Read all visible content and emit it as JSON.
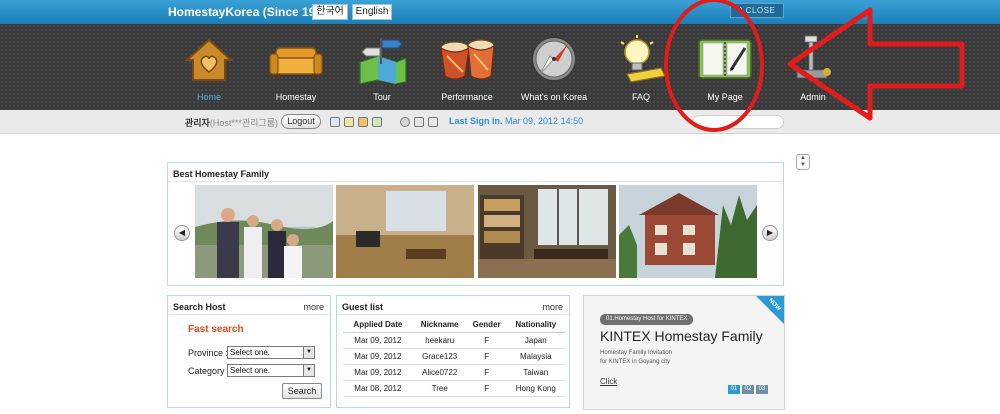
{
  "topbar": {
    "brand": "HomestayKorea (Since 1998)",
    "lang_korean": "한국어",
    "lang_english": "English",
    "close_label": "^ CLOSE"
  },
  "nav": {
    "items": [
      {
        "label": "Home",
        "icon": "home-heart-icon",
        "active": true
      },
      {
        "label": "Homestay",
        "icon": "sofa-icon"
      },
      {
        "label": "Tour",
        "icon": "map-signpost-icon"
      },
      {
        "label": "Performance",
        "icon": "drums-icon"
      },
      {
        "label": "What's on Korea",
        "icon": "compass-icon"
      },
      {
        "label": "FAQ",
        "icon": "lightbulb-icon"
      },
      {
        "label": "My Page",
        "icon": "notebook-pen-icon"
      },
      {
        "label": "Admin",
        "icon": "tools-icon"
      }
    ]
  },
  "login": {
    "user_name": "관리자",
    "user_sub": "(Host***관리그룹)",
    "logout_label": "Logout",
    "last_sign_label": "Last Sign in.",
    "last_sign_value": "Mar 09, 2012 14:50"
  },
  "best": {
    "title": "Best Homestay Family"
  },
  "search_host": {
    "title": "Search Host",
    "more": "more",
    "fast_search": "Fast search",
    "province_label": "Province :",
    "province_value": "Select one.",
    "category_label": "Category :",
    "category_value": "Select one.",
    "search_button": "Search"
  },
  "guest_list": {
    "title": "Guest list",
    "more": "more",
    "columns": [
      "Applied Date",
      "Nickname",
      "Gender",
      "Nationality"
    ],
    "rows": [
      [
        "Mar 09, 2012",
        "heekaru",
        "F",
        "Japan"
      ],
      [
        "Mar 09, 2012",
        "Grace123",
        "F",
        "Malaysia"
      ],
      [
        "Mar 09, 2012",
        "Alice0722",
        "F",
        "Taiwan"
      ],
      [
        "Mar 08, 2012",
        "Tree",
        "F",
        "Hong Kong"
      ]
    ]
  },
  "promo": {
    "badge": "NOW",
    "tag": "01.Homestay Host for KINTEX",
    "title": "KINTEX Homestay Family",
    "desc_line1": "Homestay Family Invitation",
    "desc_line2": "for KINTEX in Goyang city",
    "click": "Click",
    "pages": [
      "01",
      "02",
      "03"
    ]
  },
  "colors": {
    "topbar": "#1c7fb8",
    "nav_bg": "#3a3a3a",
    "active_nav": "#4fb3ea",
    "fast_search": "#e24a1c",
    "annotation": "#e21b1b"
  }
}
